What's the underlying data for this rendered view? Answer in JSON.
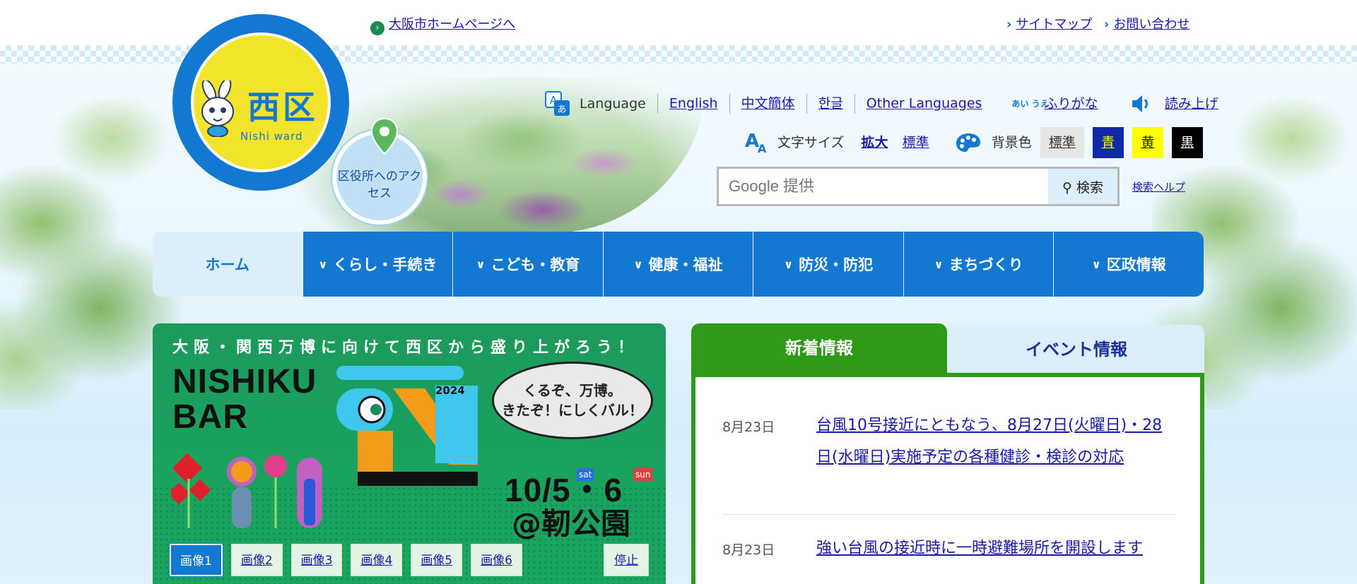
{
  "header": {
    "osaka_link": "大阪市ホームページへ",
    "sitemap": "サイトマップ",
    "contact": "お問い合わせ",
    "logo_title": "西区",
    "logo_sub": "Nishi ward",
    "access": "区役所へのアクセス"
  },
  "language": {
    "label": "Language",
    "options": [
      "English",
      "中文簡体",
      "한글",
      "Other Languages"
    ],
    "furigana_icon_text": "あい うえ",
    "furigana": "ふりがな",
    "read_aloud": "読み上げ"
  },
  "display": {
    "text_size_label": "文字サイズ",
    "enlarge": "拡大",
    "standard": "標準",
    "bg_label": "背景色",
    "bg_options": [
      {
        "label": "標準",
        "bg": "#e6e6e6",
        "fg": "#333333"
      },
      {
        "label": "青",
        "bg": "#1029a8",
        "fg": "#ffff00"
      },
      {
        "label": "黄",
        "bg": "#ffff00",
        "fg": "#222222"
      },
      {
        "label": "黒",
        "bg": "#000000",
        "fg": "#ffffff"
      }
    ]
  },
  "search": {
    "placeholder": "Google 提供",
    "button": "検索",
    "help": "検索ヘルプ"
  },
  "nav": {
    "items": [
      "ホーム",
      "くらし・手続き",
      "こども・教育",
      "健康・福祉",
      "防災・防犯",
      "まちづくり",
      "区政情報"
    ]
  },
  "slideshow": {
    "heading": "大阪・関西万博に向けて西区から盛り上がろう！",
    "title_line1": "NISHIKU",
    "title_line2": "BAR",
    "year": "2024",
    "speech_line1": "くるぞ、万博。",
    "speech_line2": "きたぞ！にしくバル！",
    "date": "10/5・6",
    "sat": "sat",
    "sun": "sun",
    "place": "@靭公園",
    "thumbs": [
      "画像1",
      "画像2",
      "画像3",
      "画像4",
      "画像5",
      "画像6"
    ],
    "stop": "停止"
  },
  "news": {
    "tab_new": "新着情報",
    "tab_event": "イベント情報",
    "items": [
      {
        "date": "8月23日",
        "text": "台風10号接近にともなう、8月27日(火曜日)・28日(水曜日)実施予定の各種健診・検診の対応"
      },
      {
        "date": "8月23日",
        "text": "強い台風の接近時に一時避難場所を開設します"
      }
    ]
  },
  "colors": {
    "brand_blue": "#1278d2",
    "news_green": "#2f9a1a",
    "logo_yellow": "#f1e42b"
  }
}
